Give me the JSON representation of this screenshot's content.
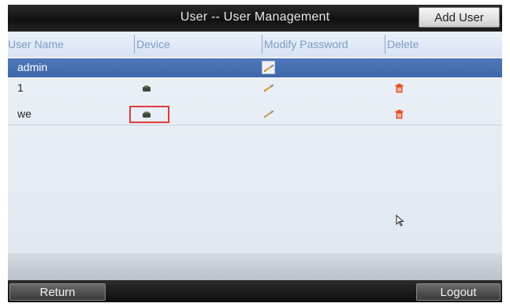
{
  "header": {
    "title": "User -- User Management",
    "add_user_label": "Add User"
  },
  "table": {
    "columns": [
      "User Name",
      "Device",
      "Modify Password",
      "Delete"
    ],
    "rows": [
      {
        "name": "admin",
        "selected": true,
        "device_icon": false,
        "modify_icon": "pencil-icon",
        "delete_icon": false
      },
      {
        "name": "1",
        "selected": false,
        "device_icon": "device-icon",
        "modify_icon": "pencil-icon",
        "delete_icon": "trash-icon"
      },
      {
        "name": "we",
        "selected": false,
        "device_icon": "device-icon",
        "modify_icon": "pencil-icon",
        "delete_icon": "trash-icon",
        "device_highlighted": true
      }
    ]
  },
  "footer": {
    "return_label": "Return",
    "logout_label": "Logout"
  },
  "colors": {
    "title_bar": "#111111",
    "header_text": "#7f9dc4",
    "selected_row": "#4a72b6",
    "highlight": "#e23b3b",
    "trash": "#e0562a"
  }
}
